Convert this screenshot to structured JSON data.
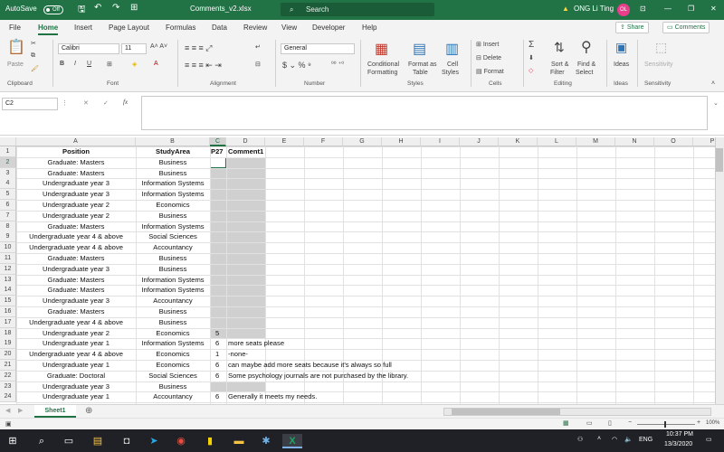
{
  "title": {
    "autosave": "AutoSave",
    "autosave_state": "Off",
    "filename": "Comments_v2.xlsx",
    "search_placeholder": "Search",
    "user": "ONG Li Ting",
    "user_initials": "OL"
  },
  "tabs": [
    "File",
    "Home",
    "Insert",
    "Page Layout",
    "Formulas",
    "Data",
    "Review",
    "View",
    "Developer",
    "Help"
  ],
  "tab_buttons": {
    "share": "Share",
    "comments": "Comments"
  },
  "ribbon": {
    "paste": "Paste",
    "font_name": "Calibri",
    "font_size": "11",
    "number_format": "General",
    "conditional": "Conditional",
    "formatting": "Formatting",
    "format_as": "Format as",
    "table": "Table",
    "cell": "Cell",
    "styles_btn": "Styles",
    "insert": "Insert",
    "delete": "Delete",
    "format": "Format",
    "sort": "Sort &",
    "filter": "Filter",
    "find": "Find &",
    "select": "Select",
    "ideas": "Ideas",
    "sensitivity": "Sensitivity",
    "groups": [
      "Clipboard",
      "Font",
      "Alignment",
      "Number",
      "Styles",
      "Cells",
      "Editing",
      "Ideas",
      "Sensitivity"
    ]
  },
  "formula_bar": {
    "name_box": "C2",
    "fx": "fx",
    "value": ""
  },
  "sheet": {
    "columns": [
      "A",
      "B",
      "C",
      "D",
      "E",
      "F",
      "G",
      "H",
      "I",
      "J",
      "K",
      "L",
      "M",
      "N",
      "O",
      "P"
    ],
    "header_row": {
      "a": "Position",
      "b": "StudyArea",
      "c": "P27",
      "d": "Comment1"
    },
    "rows": [
      {
        "n": "2",
        "a": "Graduate: Masters",
        "b": "Business",
        "c": "",
        "d": ""
      },
      {
        "n": "3",
        "a": "Graduate: Masters",
        "b": "Business",
        "c": "",
        "d": ""
      },
      {
        "n": "4",
        "a": "Undergraduate year 3",
        "b": "Information Systems",
        "c": "",
        "d": ""
      },
      {
        "n": "5",
        "a": "Undergraduate year 3",
        "b": "Information Systems",
        "c": "",
        "d": ""
      },
      {
        "n": "6",
        "a": "Undergraduate year 2",
        "b": "Economics",
        "c": "",
        "d": ""
      },
      {
        "n": "7",
        "a": "Undergraduate year 2",
        "b": "Business",
        "c": "",
        "d": ""
      },
      {
        "n": "8",
        "a": "Graduate: Masters",
        "b": "Information Systems",
        "c": "",
        "d": ""
      },
      {
        "n": "9",
        "a": "Undergraduate year 4 & above",
        "b": "Social Sciences",
        "c": "",
        "d": ""
      },
      {
        "n": "10",
        "a": "Undergraduate year 4 & above",
        "b": "Accountancy",
        "c": "",
        "d": ""
      },
      {
        "n": "11",
        "a": "Graduate: Masters",
        "b": "Business",
        "c": "",
        "d": ""
      },
      {
        "n": "12",
        "a": "Undergraduate year 3",
        "b": "Business",
        "c": "",
        "d": ""
      },
      {
        "n": "13",
        "a": "Graduate: Masters",
        "b": "Information Systems",
        "c": "",
        "d": ""
      },
      {
        "n": "14",
        "a": "Graduate: Masters",
        "b": "Information Systems",
        "c": "",
        "d": ""
      },
      {
        "n": "15",
        "a": "Undergraduate year 3",
        "b": "Accountancy",
        "c": "",
        "d": ""
      },
      {
        "n": "16",
        "a": "Graduate: Masters",
        "b": "Business",
        "c": "",
        "d": ""
      },
      {
        "n": "17",
        "a": "Undergraduate year 4 & above",
        "b": "Business",
        "c": "",
        "d": ""
      },
      {
        "n": "18",
        "a": "Undergraduate year 2",
        "b": "Economics",
        "c": "5",
        "d": ""
      },
      {
        "n": "19",
        "a": "Undergraduate year 1",
        "b": "Information Systems",
        "c": "6",
        "d": "more seats please"
      },
      {
        "n": "20",
        "a": "Undergraduate year 4 & above",
        "b": "Economics",
        "c": "1",
        "d": "-none-"
      },
      {
        "n": "21",
        "a": "Undergraduate year 1",
        "b": "Economics",
        "c": "6",
        "d": "can maybe add more seats because it's always so full"
      },
      {
        "n": "22",
        "a": "Graduate: Doctoral",
        "b": "Social Sciences",
        "c": "6",
        "d": "Some psychology journals are not purchased by the library."
      },
      {
        "n": "23",
        "a": "Undergraduate year 3",
        "b": "Business",
        "c": "",
        "d": ""
      },
      {
        "n": "24",
        "a": "Undergraduate year 1",
        "b": "Accountancy",
        "c": "6",
        "d": "Generally it meets my needs."
      }
    ],
    "tab_name": "Sheet1"
  },
  "status": {
    "zoom": "100%"
  },
  "taskbar": {
    "lang": "ENG",
    "time": "10:37 PM",
    "date": "13/3/2020"
  },
  "colors": {
    "accent": "#217346",
    "selection_fill": "#d0d0d0"
  }
}
